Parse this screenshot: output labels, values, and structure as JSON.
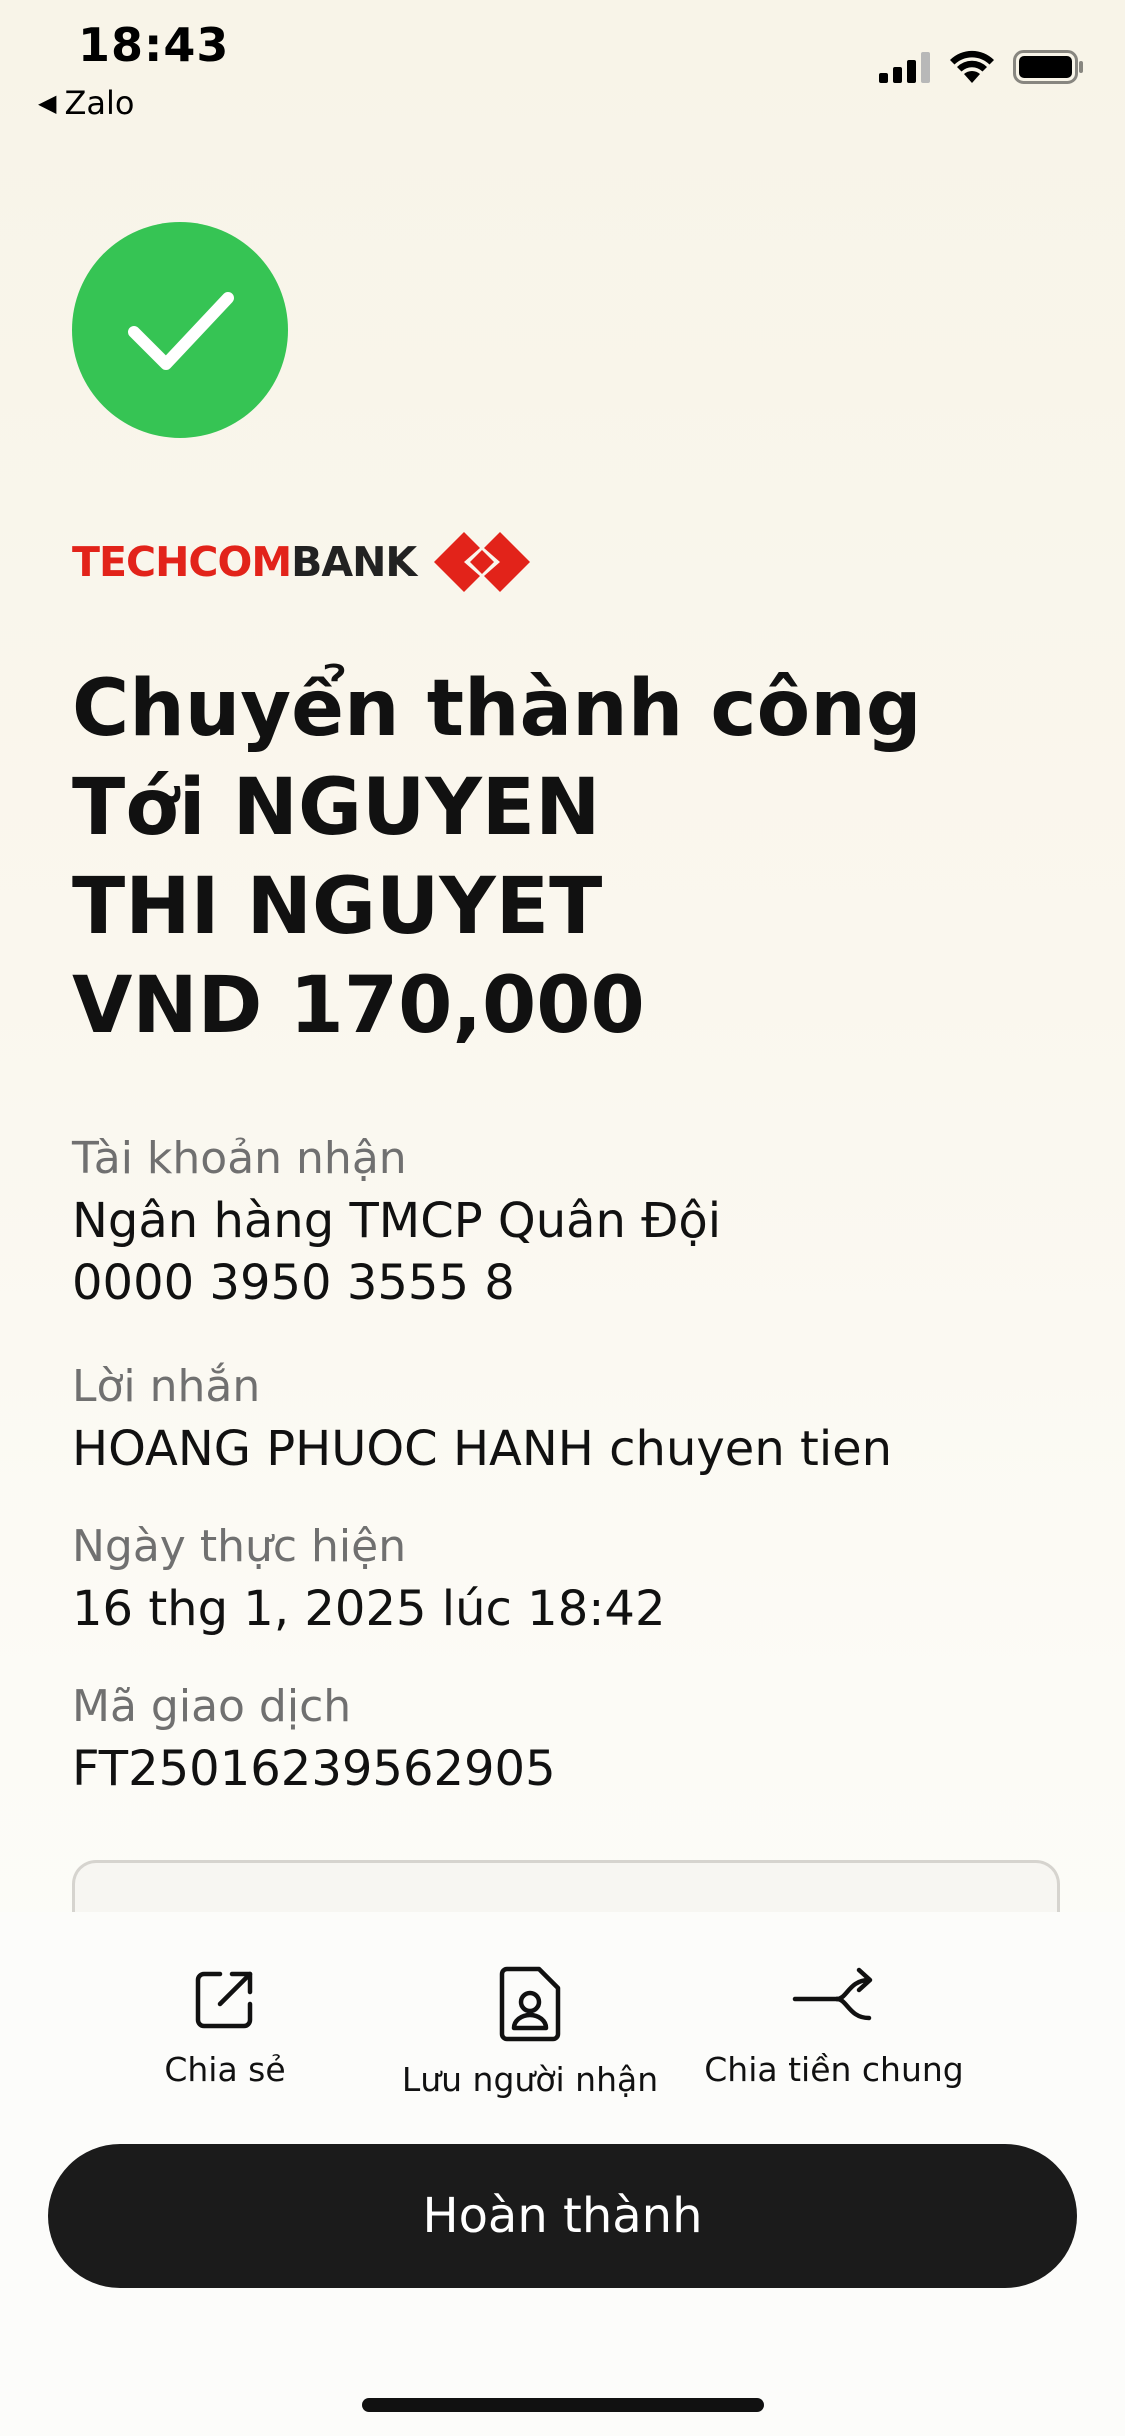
{
  "status_bar": {
    "time": "18:43",
    "back_app": "Zalo"
  },
  "bank": {
    "name_red": "TECHCOM",
    "name_dark": "BANK",
    "logo_color": "#e2231a"
  },
  "headline": {
    "line1": "Chuyển thành công",
    "line2": "Tới NGUYEN",
    "line3": "THI NGUYET",
    "line4": "VND 170,000"
  },
  "details": {
    "receiving_account_label": "Tài khoản nhận",
    "bank_name": "Ngân hàng TMCP Quân Đội",
    "account_number": "0000 3950 3555 8",
    "message_label": "Lời nhắn",
    "message": "HOANG PHUOC HANH chuyen tien",
    "date_label": "Ngày thực hiện",
    "date": "16 thg 1, 2025 lúc 18:42",
    "transaction_id_label": "Mã giao dịch",
    "transaction_id": "FT25016239562905"
  },
  "actions": {
    "share": "Chia sẻ",
    "save_recipient": "Lưu người nhận",
    "split_bill": "Chia tiền chung"
  },
  "primary_button": "Hoàn thành",
  "colors": {
    "success_green": "#36c454",
    "button_dark": "#1b1b1b",
    "label_gray": "#707070"
  },
  "icons": {
    "success": "checkmark-icon",
    "share": "share-icon",
    "save_recipient": "contact-card-icon",
    "split_bill": "split-arrow-icon"
  }
}
